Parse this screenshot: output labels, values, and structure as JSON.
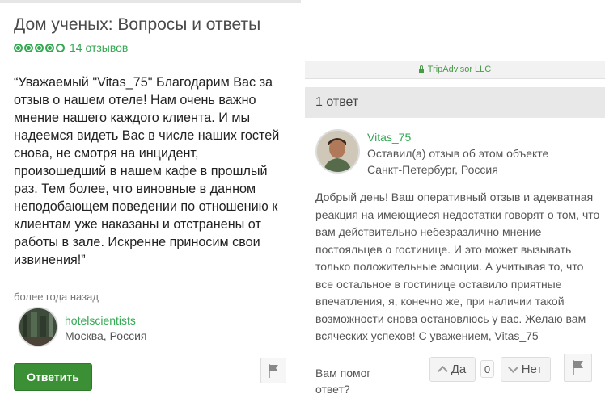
{
  "left": {
    "title": "Дом ученых: Вопросы и ответы",
    "rating": {
      "bubbles_filled": 4,
      "bubbles_total": 5,
      "count_text": "14 отзывов"
    },
    "quote": "“Уважаемый \"Vitas_75\" Благодарим Вас за отзыв о нашем отеле! Нам очень важно мнение нашего каждого клиента. И мы надеемся видеть Вас в числе наших гостей снова, не смотря на инцидент, произошедший в нашем кафе в прошлый раз. Тем более, что виновные в данном неподобающем поведении по отношению к клиентам уже наказаны и отстранены от работы в зале. Искренне приносим свои извинения!”",
    "time_ago": "более года назад",
    "user": {
      "name": "hotelscientists",
      "location": "Москва, Россия"
    },
    "reply_button": "Ответить",
    "flag_icon": "flag-icon"
  },
  "right": {
    "url_host": "TripAdvisor LLC",
    "answers_header": "1 ответ",
    "user": {
      "name": "Vitas_75",
      "role": "Оставил(а) отзыв об этом объекте",
      "location": "Санкт-Петербург, Россия"
    },
    "answer_text": "Добрый день! Ваш оперативный отзыв и адекватная реакция на имеющиеся недостатки говорят о том, что вам действительно небезразлично мнение постояльцев о гостинице. И это может вызывать только положительные эмоции. А учитывая то, что все остальное в гостинице оставило приятные впечатления, я, конечно же, при наличии такой возможности снова остановлюсь у вас. Желаю вам всяческих успехов! С уважением, Vitas_75",
    "helpful_question": "Вам помог ответ?",
    "vote_yes": "Да",
    "vote_count": "0",
    "vote_no": "Нет",
    "flag_icon": "flag-icon"
  },
  "colors": {
    "accent_green": "#34a853",
    "button_green": "#3b8f35"
  }
}
